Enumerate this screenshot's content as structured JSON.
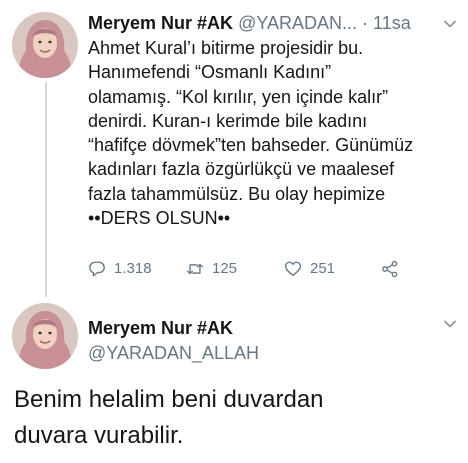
{
  "tweet1": {
    "author_name": "Meryem Nur #AK",
    "author_handle": "@YARADAN...",
    "separator": " · ",
    "time": "11sa",
    "text_lines": [
      "Ahmet Kural’ı bitirme projesidir bu.",
      "Hanımefendi “Osmanlı Kadını”",
      "olamamış. “Kol kırılır, yen içinde kalır”",
      "denirdi. Kuran-ı kerimde bile kadını",
      "“hafifçe dövmek”ten bahseder. Günümüz",
      "kadınları fazla özgürlükçü ve maalesef",
      "fazla tahammülsüz.  Bu olay hepimize",
      "••DERS OLSUN••"
    ],
    "actions": {
      "reply_count": "1.318",
      "retweet_count": "125",
      "like_count": "251"
    }
  },
  "tweet2": {
    "author_name": "Meryem Nur #AK",
    "author_handle": "@YARADAN_ALLAH",
    "text_lines": [
      "Benim helalim beni duvardan",
      "duvara vurabilir."
    ]
  },
  "colors": {
    "text": "#14171a",
    "secondary": "#657786",
    "thread_line": "#cfd9de",
    "hijab": "#c98f97"
  },
  "icons": [
    "reply-icon",
    "retweet-icon",
    "like-icon",
    "share-icon",
    "chevron-down-icon"
  ]
}
